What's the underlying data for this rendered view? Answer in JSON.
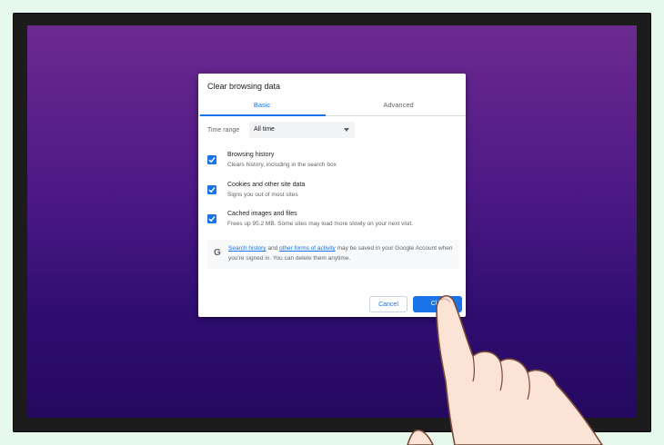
{
  "dialog": {
    "title": "Clear browsing data",
    "tabs": [
      {
        "label": "Basic",
        "active": true
      },
      {
        "label": "Advanced",
        "active": false
      }
    ],
    "time_range": {
      "label": "Time range",
      "value": "All time"
    },
    "options": [
      {
        "title": "Browsing history",
        "desc": "Clears history, including in the search box",
        "checked": true
      },
      {
        "title": "Cookies and other site data",
        "desc": "Signs you out of most sites",
        "checked": true
      },
      {
        "title": "Cached images and files",
        "desc": "Frees up 95.2 MB. Some sites may load more slowly on your next visit.",
        "checked": true
      }
    ],
    "info": {
      "icon": "google-g-icon",
      "link1": "Search history",
      "and": " and ",
      "link2": "other forms of activity",
      "rest": " may be saved in your Google Account when you're signed in. You can delete them anytime."
    },
    "buttons": {
      "cancel": "Cancel",
      "clear": "Clea"
    }
  },
  "colors": {
    "accent": "#1a73e8",
    "screen_top": "#6c2a8f",
    "screen_bottom": "#25095f",
    "page_bg": "#e6f8ec"
  }
}
